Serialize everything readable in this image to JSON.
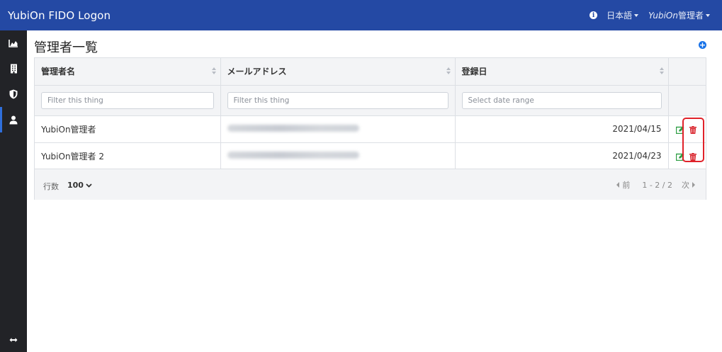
{
  "app": {
    "title": "YubiOn FIDO Logon"
  },
  "header": {
    "language": "日本語",
    "user_italic": "YubiOn",
    "user_suffix": "管理者"
  },
  "sidebar": {
    "items": [
      {
        "icon": "chart-icon"
      },
      {
        "icon": "building-icon"
      },
      {
        "icon": "shield-icon"
      },
      {
        "icon": "user-icon",
        "active": true
      }
    ],
    "bottom_icon": "expand-arrows-icon"
  },
  "page": {
    "title": "管理者一覧"
  },
  "table": {
    "columns": [
      "管理者名",
      "メールアドレス",
      "登録日"
    ],
    "filters": {
      "name_placeholder": "Filter this thing",
      "email_placeholder": "Filter this thing",
      "date_placeholder": "Select date range"
    },
    "rows": [
      {
        "name": "YubiOn管理者",
        "date": "2021/04/15"
      },
      {
        "name": "YubiOn管理者 2",
        "date": "2021/04/23"
      }
    ]
  },
  "footer": {
    "rows_label": "行数",
    "rows_value": "100",
    "prev_label": "前",
    "range": "1 - 2 / 2",
    "next_label": "次"
  },
  "colors": {
    "header": "#2449a4",
    "sidebar": "#222327",
    "edit": "#2e9e44",
    "delete": "#d9232b",
    "highlight": "#e0222a"
  }
}
